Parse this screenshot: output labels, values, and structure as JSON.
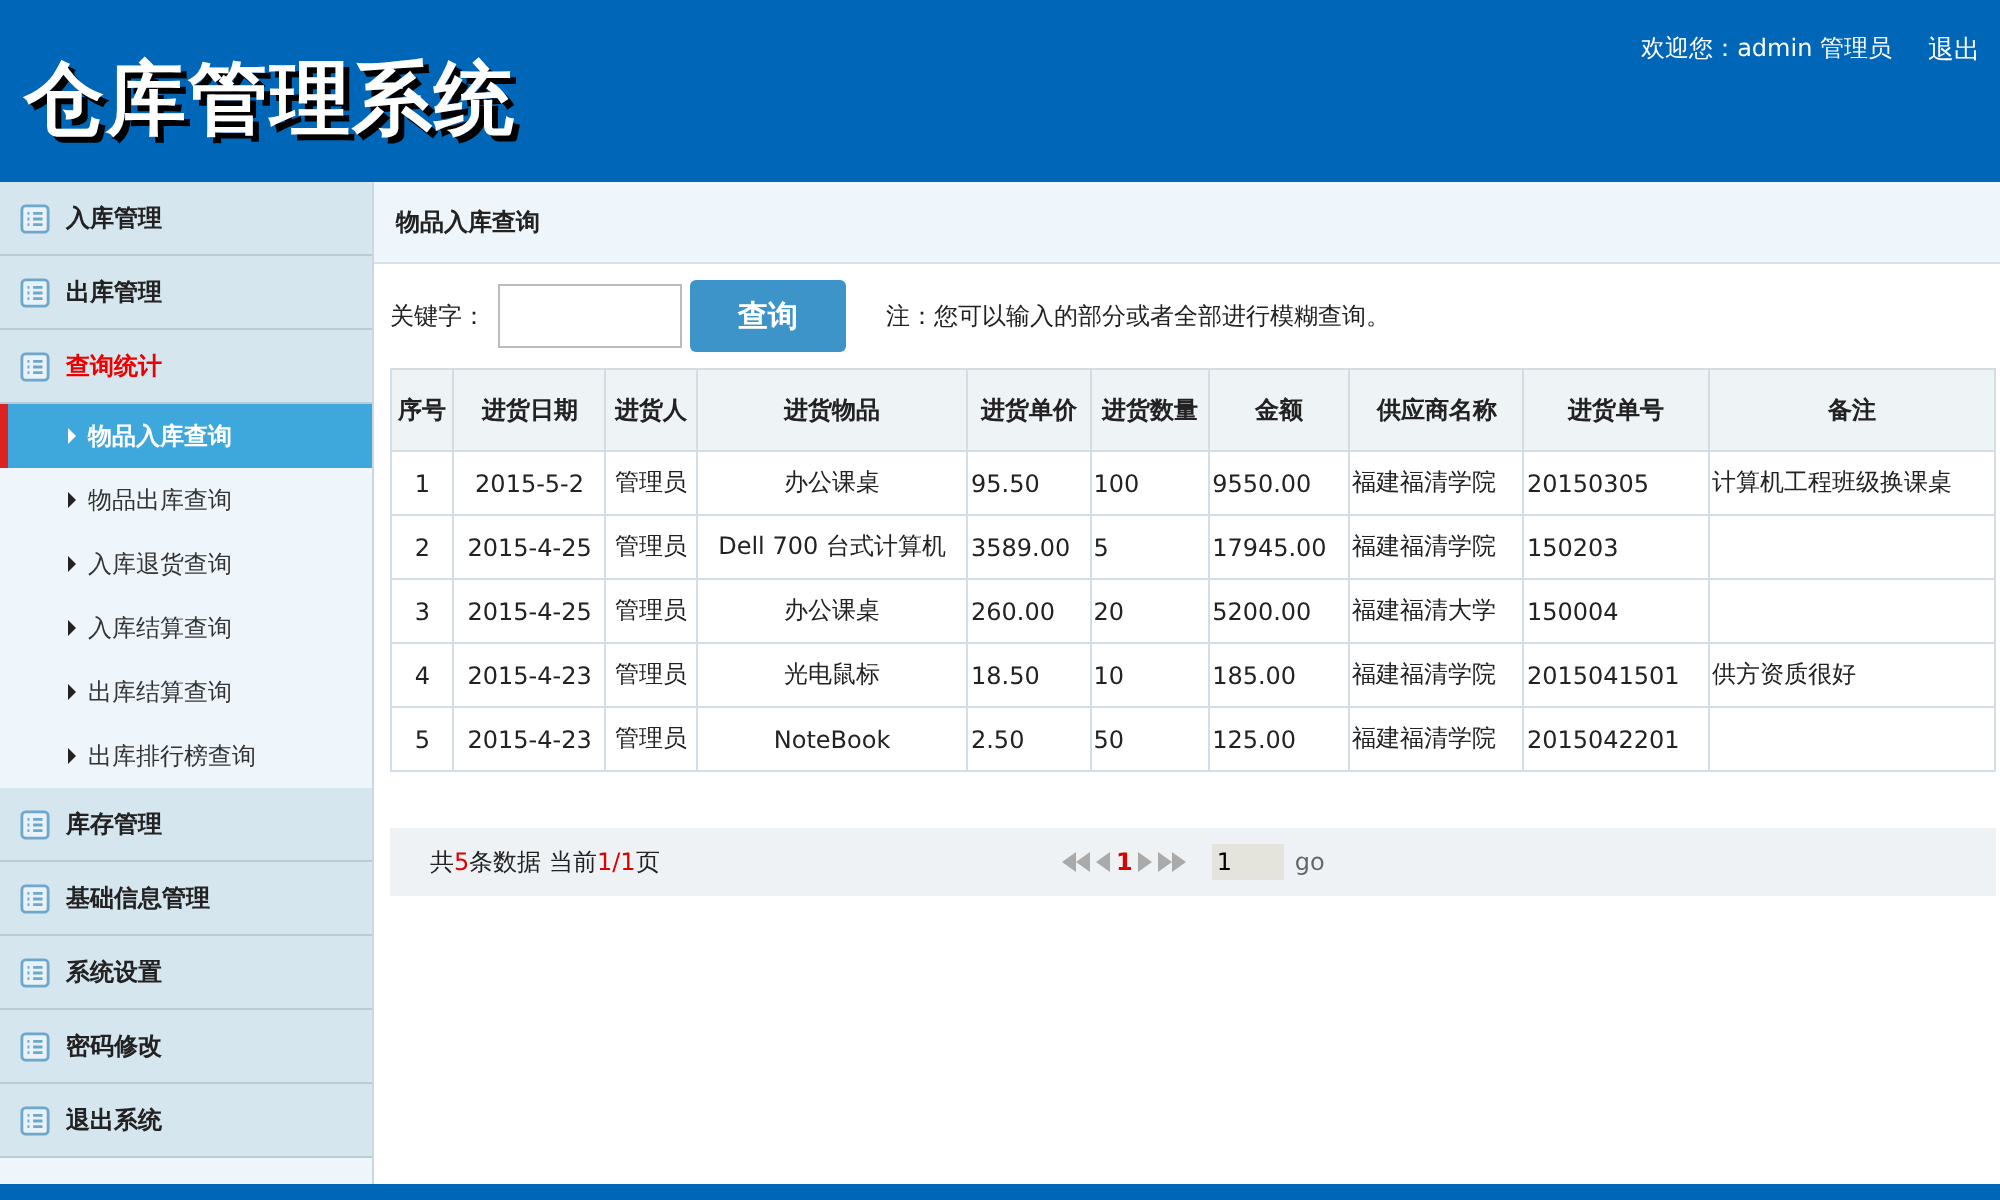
{
  "header": {
    "title": "仓库管理系统",
    "welcome": "欢迎您：admin 管理员",
    "logout": "退出"
  },
  "sidebar": {
    "groups": [
      {
        "label": "入库管理",
        "selected": false
      },
      {
        "label": "出库管理",
        "selected": false
      },
      {
        "label": "查询统计",
        "selected": true,
        "children": [
          {
            "label": "物品入库查询",
            "selected": true
          },
          {
            "label": "物品出库查询",
            "selected": false
          },
          {
            "label": "入库退货查询",
            "selected": false
          },
          {
            "label": "入库结算查询",
            "selected": false
          },
          {
            "label": "出库结算查询",
            "selected": false
          },
          {
            "label": "出库排行榜查询",
            "selected": false
          }
        ]
      },
      {
        "label": "库存管理",
        "selected": false
      },
      {
        "label": "基础信息管理",
        "selected": false
      },
      {
        "label": "系统设置",
        "selected": false
      },
      {
        "label": "密码修改",
        "selected": false
      },
      {
        "label": "退出系统",
        "selected": false
      }
    ]
  },
  "page_title": "物品入库查询",
  "search": {
    "label": "关键字：",
    "button": "查询",
    "note": "注：您可以输入的部分或者全部进行模糊查询。"
  },
  "table": {
    "columns": [
      "序号",
      "进货日期",
      "进货人",
      "进货物品",
      "进货单价",
      "进货数量",
      "金额",
      "供应商名称",
      "进货单号",
      "备注"
    ],
    "rows": [
      [
        "1",
        "2015-5-2",
        "管理员",
        "办公课桌",
        "95.50",
        "100",
        "9550.00",
        "福建福清学院",
        "20150305",
        "计算机工程班级换课桌"
      ],
      [
        "2",
        "2015-4-25",
        "管理员",
        "Dell 700 台式计算机",
        "3589.00",
        "5",
        "17945.00",
        "福建福清学院",
        "150203",
        ""
      ],
      [
        "3",
        "2015-4-25",
        "管理员",
        "办公课桌",
        "260.00",
        "20",
        "5200.00",
        "福建福清大学",
        "150004",
        ""
      ],
      [
        "4",
        "2015-4-23",
        "管理员",
        "光电鼠标",
        "18.50",
        "10",
        "185.00",
        "福建福清学院",
        "2015041501",
        "供方资质很好"
      ],
      [
        "5",
        "2015-4-23",
        "管理员",
        "NoteBook",
        "2.50",
        "50",
        "125.00",
        "福建福清学院",
        "2015042201",
        ""
      ]
    ]
  },
  "pager": {
    "summary": [
      {
        "text": "共",
        "highlight": false
      },
      {
        "text": "5",
        "highlight": true
      },
      {
        "text": "条数据 当前",
        "highlight": false
      },
      {
        "text": "1/1",
        "highlight": true
      },
      {
        "text": "页",
        "highlight": false
      }
    ],
    "current_page": "1",
    "page_input": "1",
    "go": "go"
  }
}
